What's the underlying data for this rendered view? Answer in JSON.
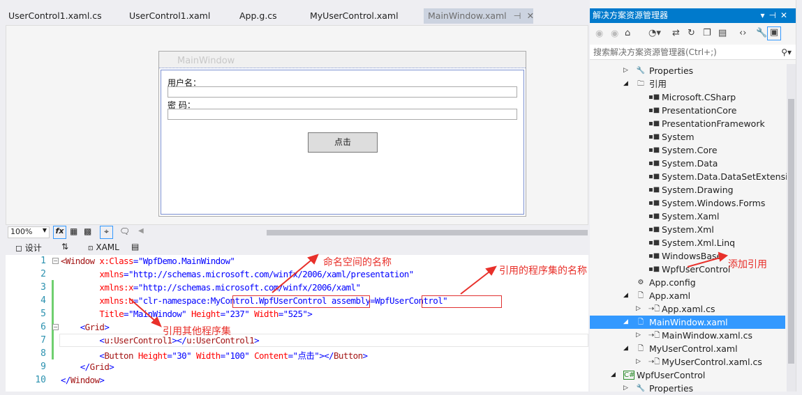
{
  "tabs": [
    {
      "label": "UserControl1.xaml.cs"
    },
    {
      "label": "UserControl1.xaml"
    },
    {
      "label": "App.g.cs"
    },
    {
      "label": "MyUserControl.xaml"
    },
    {
      "label": "MainWindow.xaml",
      "active": true
    }
  ],
  "designer": {
    "window_title": "MainWindow",
    "username_label": "用户名：",
    "password_label": "密 码：",
    "button_label": "点击"
  },
  "toolbar": {
    "zoom": "100%",
    "fx": "fx"
  },
  "view_tabs": {
    "design": "设计",
    "swap": "⇅",
    "xaml": "XAML"
  },
  "code": {
    "lines": [
      {
        "n": "1",
        "parts": [
          [
            "t",
            "<Window "
          ],
          [
            "a",
            "x:Class"
          ],
          [
            "p",
            "=\""
          ],
          [
            "v",
            "WpfDemo.MainWindow"
          ],
          [
            "p",
            "\""
          ]
        ]
      },
      {
        "n": "2",
        "parts": [
          [
            "a",
            "        xmlns"
          ],
          [
            "p",
            "=\""
          ],
          [
            "v",
            "http://schemas.microsoft.com/winfx/2006/xaml/presentation"
          ],
          [
            "p",
            "\""
          ]
        ]
      },
      {
        "n": "3",
        "parts": [
          [
            "a",
            "        xmlns:x"
          ],
          [
            "p",
            "=\""
          ],
          [
            "v",
            "http://schemas.microsoft.com/winfx/2006/xaml"
          ],
          [
            "p",
            "\""
          ]
        ]
      },
      {
        "n": "4",
        "parts": [
          [
            "a",
            "        xmlns:u"
          ],
          [
            "p",
            "=\""
          ],
          [
            "v",
            "clr-namespace:MyControl.WpfUserControl assembly=WpfUserControl"
          ],
          [
            "p",
            "\""
          ]
        ]
      },
      {
        "n": "5",
        "parts": [
          [
            "a",
            "        Title"
          ],
          [
            "p",
            "=\""
          ],
          [
            "v",
            "MainWindow"
          ],
          [
            "p",
            "\" "
          ],
          [
            "a",
            "Height"
          ],
          [
            "p",
            "=\""
          ],
          [
            "v",
            "237"
          ],
          [
            "p",
            "\" "
          ],
          [
            "a",
            "Width"
          ],
          [
            "p",
            "=\""
          ],
          [
            "v",
            "525"
          ],
          [
            "p",
            "\">"
          ]
        ]
      },
      {
        "n": "6",
        "parts": [
          [
            "p",
            "    <"
          ],
          [
            "t",
            "Grid"
          ],
          [
            "p",
            ">"
          ]
        ]
      },
      {
        "n": "7",
        "parts": [
          [
            "p",
            "        <"
          ],
          [
            "t",
            "u:UserControl1"
          ],
          [
            "p",
            "></"
          ],
          [
            "t",
            "u:UserControl1"
          ],
          [
            "p",
            ">"
          ]
        ]
      },
      {
        "n": "8",
        "parts": [
          [
            "p",
            "        <"
          ],
          [
            "t",
            "Button "
          ],
          [
            "a",
            "Height"
          ],
          [
            "p",
            "=\""
          ],
          [
            "v",
            "30"
          ],
          [
            "p",
            "\" "
          ],
          [
            "a",
            "Width"
          ],
          [
            "p",
            "=\""
          ],
          [
            "v",
            "100"
          ],
          [
            "p",
            "\" "
          ],
          [
            "a",
            "Content"
          ],
          [
            "p",
            "=\""
          ],
          [
            "v",
            "点击"
          ],
          [
            "p",
            "\"></"
          ],
          [
            "t",
            "Button"
          ],
          [
            "p",
            ">"
          ]
        ]
      },
      {
        "n": "9",
        "parts": [
          [
            "p",
            "    </"
          ],
          [
            "t",
            "Grid"
          ],
          [
            "p",
            ">"
          ]
        ]
      },
      {
        "n": "10",
        "parts": [
          [
            "p",
            "</"
          ],
          [
            "t",
            "Window"
          ],
          [
            "p",
            ">"
          ]
        ]
      }
    ]
  },
  "annotations": {
    "namespace": "命名空间的名称",
    "assembly": "引用的程序集的名称",
    "other": "引用其他程序集",
    "add_ref": "添加引用"
  },
  "solution_explorer": {
    "title": "解决方案资源管理器",
    "search_placeholder": "搜索解决方案资源管理器(Ctrl+;)",
    "items": [
      {
        "label": "Properties",
        "icon": "wrench-icon",
        "exp": "▷",
        "lvl": 1
      },
      {
        "label": "引用",
        "icon": "folder-icon",
        "exp": "◢",
        "lvl": 1
      },
      {
        "label": "Microsoft.CSharp",
        "icon": "reference-icon",
        "lvl": 2
      },
      {
        "label": "PresentationCore",
        "icon": "reference-icon",
        "lvl": 2
      },
      {
        "label": "PresentationFramework",
        "icon": "reference-icon",
        "lvl": 2
      },
      {
        "label": "System",
        "icon": "reference-icon",
        "lvl": 2
      },
      {
        "label": "System.Core",
        "icon": "reference-icon",
        "lvl": 2
      },
      {
        "label": "System.Data",
        "icon": "reference-icon",
        "lvl": 2
      },
      {
        "label": "System.Data.DataSetExtensions",
        "icon": "reference-icon",
        "lvl": 2
      },
      {
        "label": "System.Drawing",
        "icon": "reference-icon",
        "lvl": 2
      },
      {
        "label": "System.Windows.Forms",
        "icon": "reference-icon",
        "lvl": 2
      },
      {
        "label": "System.Xaml",
        "icon": "reference-icon",
        "lvl": 2
      },
      {
        "label": "System.Xml",
        "icon": "reference-icon",
        "lvl": 2
      },
      {
        "label": "System.Xml.Linq",
        "icon": "reference-icon",
        "lvl": 2
      },
      {
        "label": "WindowsBase",
        "icon": "reference-icon",
        "lvl": 2
      },
      {
        "label": "WpfUserControl",
        "icon": "reference-icon",
        "lvl": 2
      },
      {
        "label": "App.config",
        "icon": "config-icon",
        "lvl": 1
      },
      {
        "label": "App.xaml",
        "icon": "xaml-file-icon",
        "exp": "◢",
        "lvl": 1
      },
      {
        "label": "App.xaml.cs",
        "icon": "cs-file-icon",
        "exp": "▷",
        "lvl": 2
      },
      {
        "label": "MainWindow.xaml",
        "icon": "xaml-file-icon",
        "exp": "◢",
        "lvl": 1,
        "selected": true
      },
      {
        "label": "MainWindow.xaml.cs",
        "icon": "cs-file-icon",
        "exp": "▷",
        "lvl": 2
      },
      {
        "label": "MyUserControl.xaml",
        "icon": "xaml-file-icon",
        "exp": "◢",
        "lvl": 1
      },
      {
        "label": "MyUserControl.xaml.cs",
        "icon": "cs-file-icon",
        "exp": "▷",
        "lvl": 2
      },
      {
        "label": "WpfUserControl",
        "icon": "csharp-project-icon",
        "exp": "◢",
        "lvl": 0
      },
      {
        "label": "Properties",
        "icon": "wrench-icon",
        "exp": "▷",
        "lvl": 1
      }
    ]
  }
}
